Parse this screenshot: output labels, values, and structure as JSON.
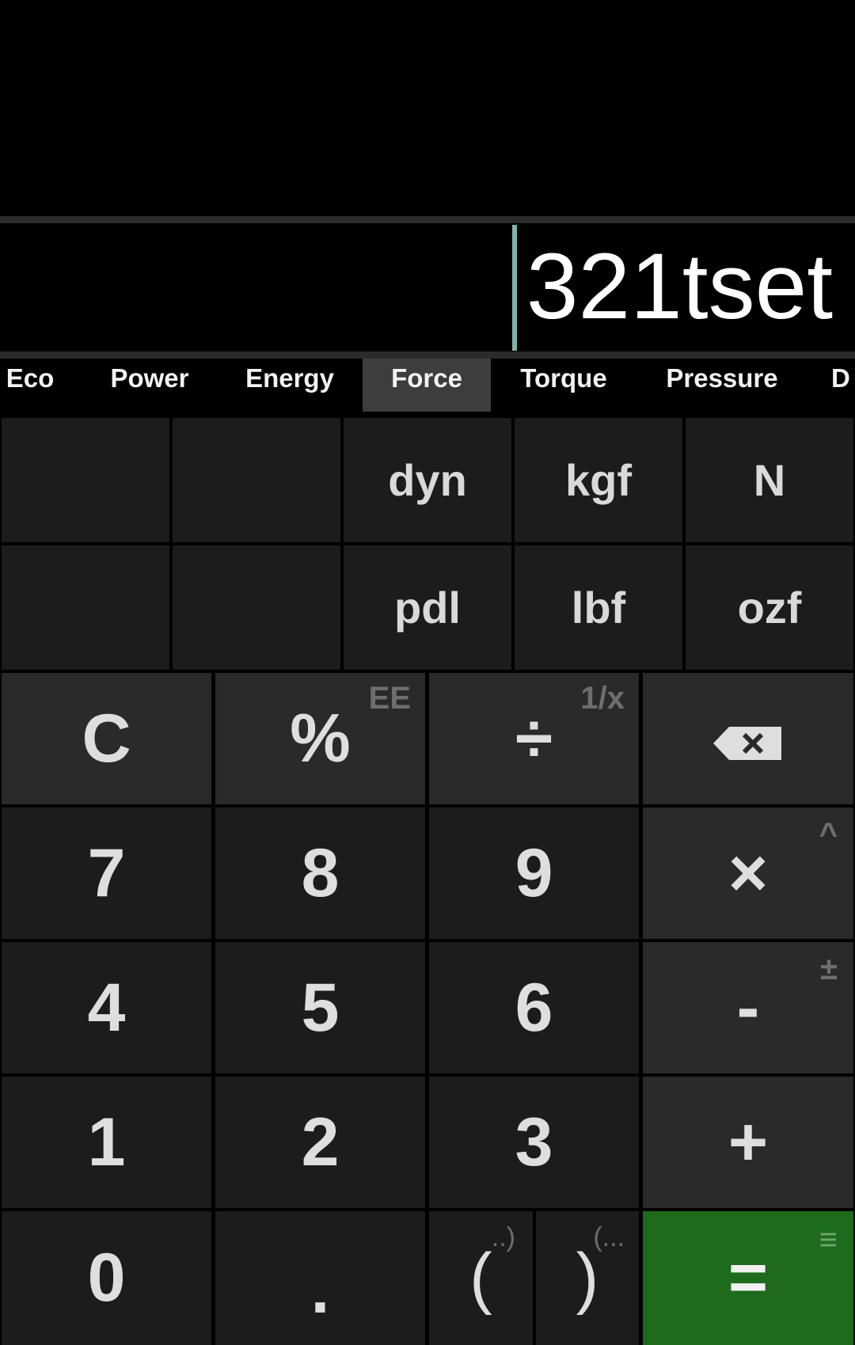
{
  "display": {
    "expression": "321tset"
  },
  "tabs": [
    {
      "label": "Eco",
      "active": false
    },
    {
      "label": "Power",
      "active": false
    },
    {
      "label": "Energy",
      "active": false
    },
    {
      "label": "Force",
      "active": true
    },
    {
      "label": "Torque",
      "active": false
    },
    {
      "label": "Pressure",
      "active": false
    },
    {
      "label": "D",
      "active": false
    }
  ],
  "units": {
    "row1": [
      "",
      "",
      "dyn",
      "kgf",
      "N"
    ],
    "row2": [
      "",
      "",
      "pdl",
      "lbf",
      "ozf"
    ]
  },
  "keys": {
    "clear": "C",
    "percent": "%",
    "percent_alt": "EE",
    "divide": "÷",
    "divide_alt": "1/x",
    "seven": "7",
    "eight": "8",
    "nine": "9",
    "multiply": "×",
    "multiply_alt": "^",
    "four": "4",
    "five": "5",
    "six": "6",
    "minus": "-",
    "minus_alt": "±",
    "one": "1",
    "two": "2",
    "three": "3",
    "plus": "+",
    "zero": "0",
    "dot": ".",
    "open_paren": "(",
    "open_paren_alt": "..)",
    "close_paren": ")",
    "close_paren_alt": "(...",
    "equals": "=",
    "equals_alt": "≡"
  },
  "colors": {
    "equals_bg": "#1e6b1e",
    "cursor": "#7fb5ad",
    "active_tab_bg": "#3d3d3d"
  }
}
